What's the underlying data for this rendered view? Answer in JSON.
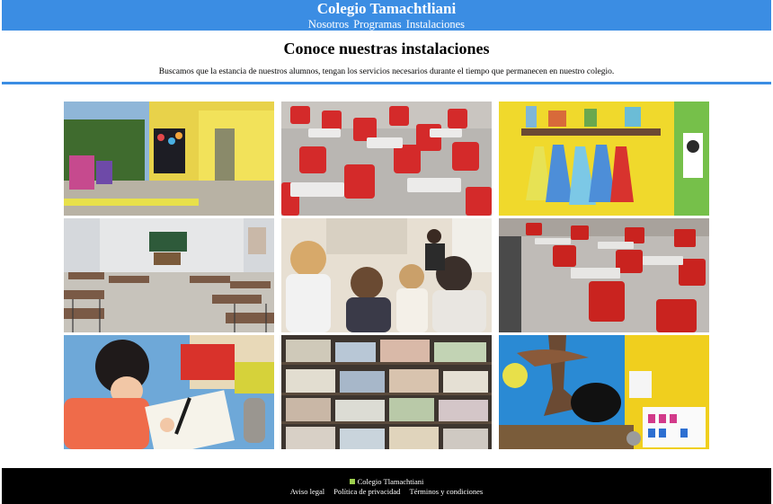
{
  "header": {
    "brand": "Colegio Tamachtliani",
    "nav": [
      "Nosotros",
      "Programas",
      "Instalaciones"
    ]
  },
  "intro": {
    "title": "Conoce nuestras instalaciones",
    "text": "Buscamos que la estancia de nuestros alumnos, tengan los servicios necesarios durante el tiempo que permanecen en nuestro colegio."
  },
  "gallery": [
    {
      "name": "patio-photo"
    },
    {
      "name": "red-chairs-classroom-photo"
    },
    {
      "name": "coat-hooks-wall-photo"
    },
    {
      "name": "empty-classroom-photo"
    },
    {
      "name": "children-circle-photo"
    },
    {
      "name": "red-desks-photo"
    },
    {
      "name": "child-writing-photo"
    },
    {
      "name": "library-shelves-photo"
    },
    {
      "name": "decorated-wall-photo"
    }
  ],
  "footer": {
    "brand": "Colegio Tlamachtiani",
    "links": [
      "Aviso legal",
      "Política de privacidad",
      "Términos y condiciones"
    ]
  },
  "colors": {
    "accent": "#3b8de3",
    "footer_bg": "#000000"
  }
}
